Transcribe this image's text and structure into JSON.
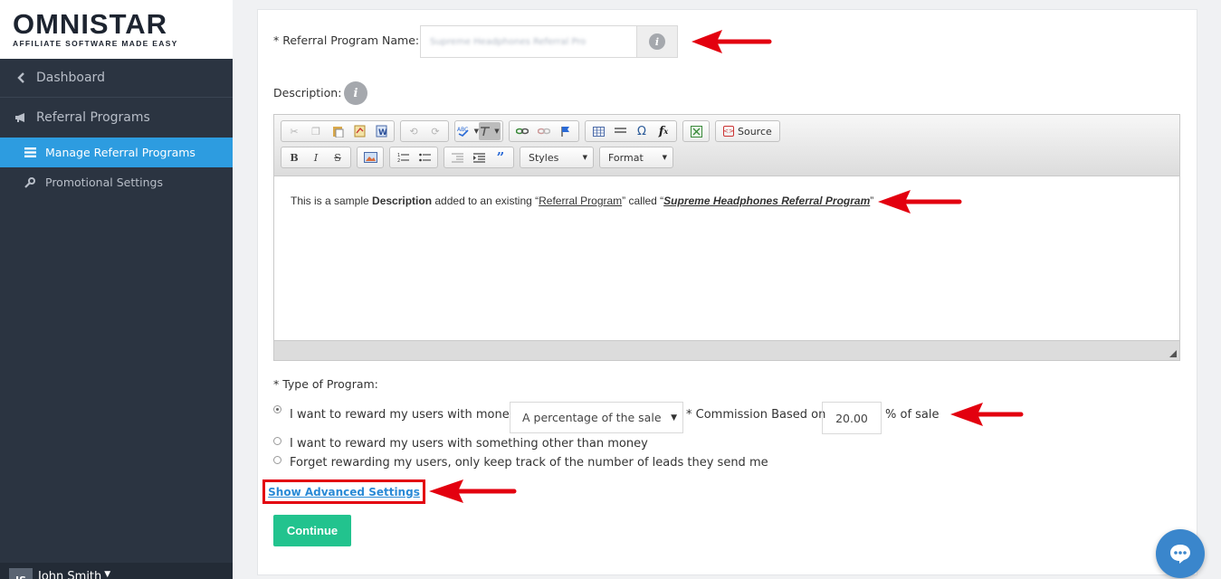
{
  "logo": {
    "name": "OMNISTAR",
    "tagline": "AFFILIATE SOFTWARE MADE EASY"
  },
  "sidebar": {
    "dashboard": "Dashboard",
    "referral_programs": "Referral Programs",
    "items": [
      {
        "label": "Manage Referral Programs",
        "active": true
      },
      {
        "label": "Promotional Settings",
        "active": false
      }
    ],
    "user": {
      "initials": "JS",
      "name": "John Smith"
    }
  },
  "form": {
    "program_name_label": "* Referral Program Name:",
    "program_name_value": "Supreme Headphones Referral Pro",
    "description_label": "Description:",
    "info_icon": "i",
    "toolbar": {
      "source_label": "Source",
      "styles_label": "Styles",
      "format_label": "Format"
    },
    "description_text": {
      "part1": "This is a sample ",
      "bold": "Description",
      "part2": " added to an existing “",
      "link1": "Referral Program",
      "part3": "” called “",
      "link2": "Supreme Headphones Referral Program",
      "part4": "”"
    },
    "type_label": "* Type of Program:",
    "options": [
      {
        "label": "I want to reward my users with money",
        "checked": true
      },
      {
        "label": "I want to reward my users with something other than money",
        "checked": false
      },
      {
        "label": "Forget rewarding my users, only keep track of the number of leads they send me",
        "checked": false
      }
    ],
    "reward_type_selected": "A percentage of the sale",
    "commission_label": "* Commission Based on",
    "commission_value": "20.00",
    "commission_suffix": "% of sale",
    "advanced_link": "Show Advanced Settings",
    "continue_button": "Continue"
  },
  "colors": {
    "sidebar_bg": "#2b3441",
    "active_item": "#2d9ce0",
    "continue_button": "#22c38e",
    "link": "#2a8ad6",
    "annotation_arrow": "#e3000f",
    "chat_bubble": "#3a86cc"
  }
}
